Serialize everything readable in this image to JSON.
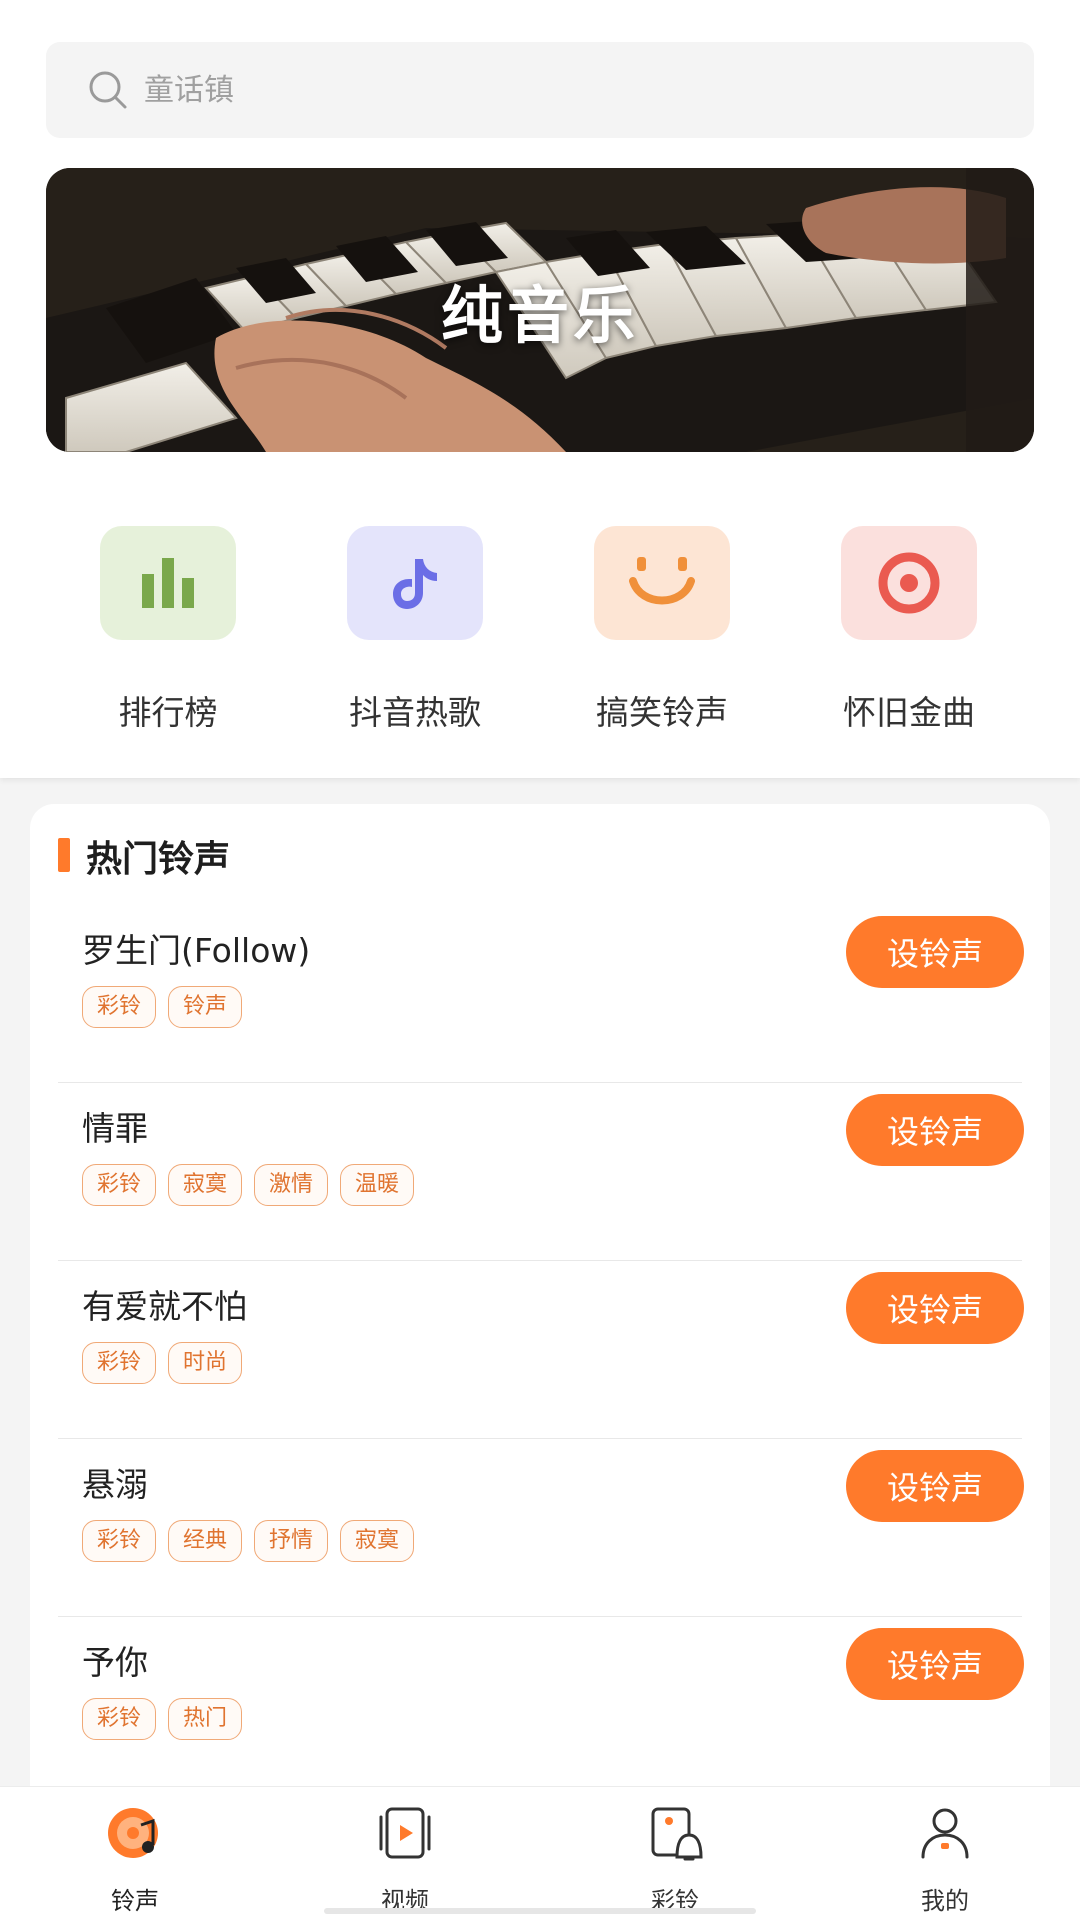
{
  "search": {
    "placeholder": "童话镇",
    "icon": "search-icon"
  },
  "banner": {
    "title": "纯音乐"
  },
  "categories": [
    {
      "label": "排行榜",
      "icon": "chart-bars-icon",
      "bg": "#e6f1da",
      "color": "#7aa84b"
    },
    {
      "label": "抖音热歌",
      "icon": "tiktok-note-icon",
      "bg": "#e4e4fb",
      "color": "#6b6ee6"
    },
    {
      "label": "搞笑铃声",
      "icon": "smile-icon",
      "bg": "#fde5d4",
      "color": "#f0903a"
    },
    {
      "label": "怀旧金曲",
      "icon": "target-icon",
      "bg": "#fbe0dd",
      "color": "#ea5a50"
    }
  ],
  "hot": {
    "title": "热门铃声",
    "button_label": "设铃声",
    "items": [
      {
        "title": "罗生门(Follow)",
        "tags": [
          "彩铃",
          "铃声"
        ]
      },
      {
        "title": "情罪",
        "tags": [
          "彩铃",
          "寂寞",
          "激情",
          "温暖"
        ]
      },
      {
        "title": "有爱就不怕",
        "tags": [
          "彩铃",
          "时尚"
        ]
      },
      {
        "title": "悬溺",
        "tags": [
          "彩铃",
          "经典",
          "抒情",
          "寂寞"
        ]
      },
      {
        "title": "予你",
        "tags": [
          "彩铃",
          "热门"
        ]
      }
    ]
  },
  "nav": [
    {
      "label": "铃声",
      "icon": "ringtone-disc-icon",
      "active": true
    },
    {
      "label": "视频",
      "icon": "video-play-icon",
      "active": false
    },
    {
      "label": "彩铃",
      "icon": "phone-bell-icon",
      "active": false
    },
    {
      "label": "我的",
      "icon": "user-icon",
      "active": false
    }
  ],
  "colors": {
    "accent": "#ff7a2b",
    "tag_border": "#f0a977",
    "tag_text": "#e07430"
  }
}
